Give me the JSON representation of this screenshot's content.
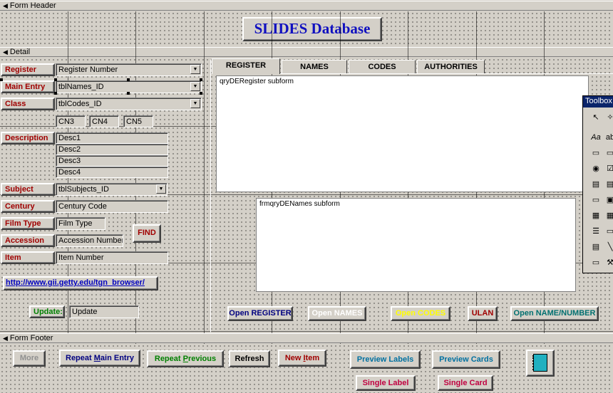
{
  "sections": {
    "header": "Form Header",
    "detail": "Detail",
    "footer": "Form Footer"
  },
  "title": "SLIDES Database",
  "fields": [
    {
      "label": "Register",
      "value": "Register Number",
      "dropdown": true
    },
    {
      "label": "Main Entry",
      "value": "tblNames_ID",
      "dropdown": true
    },
    {
      "label": "Class",
      "value": "tblCodes_ID",
      "dropdown": true
    }
  ],
  "cn_boxes": [
    "CN3",
    "CN4",
    "CN5"
  ],
  "description": {
    "label": "Description",
    "values": [
      "Desc1",
      "Desc2",
      "Desc3",
      "Desc4"
    ]
  },
  "subject": {
    "label": "Subject",
    "value": "tblSubjects_ID"
  },
  "century": {
    "label": "Century",
    "value": "Century Code"
  },
  "film_type": {
    "label": "Film Type",
    "value": "Film Type"
  },
  "accession": {
    "label": "Accession",
    "value": "Accession Number"
  },
  "item": {
    "label": "Item",
    "value": "Item Number"
  },
  "find_button": "FIND",
  "link": "http://www.gii.getty.edu/tgn_browser/",
  "update": {
    "label": "Update:",
    "value": "Update"
  },
  "tabs": [
    "REGISTER",
    "NAMES",
    "CODES",
    "AUTHORITIES"
  ],
  "subforms": {
    "register": "qryDERegister subform",
    "names": "frmqryDENames subform"
  },
  "detail_buttons": [
    {
      "label": "Open REGISTER",
      "color": "#000080"
    },
    {
      "label": "Open NAMES",
      "color": "#ffffff"
    },
    {
      "label": "Open CODES",
      "color": "#ffff00"
    },
    {
      "label": "ULAN",
      "color": "#a00000"
    },
    {
      "label": "Open NAME/NUMBER",
      "color": "#007070"
    }
  ],
  "footer_buttons": {
    "more": "More",
    "repeat_main_entry": "Repeat Main Entry",
    "repeat_previous": "Repeat Previous",
    "refresh": "Refresh",
    "new_item": "New Item",
    "preview_labels": "Preview Labels",
    "preview_cards": "Preview Cards",
    "single_label": "Single Label",
    "single_card": "Single Card"
  },
  "toolbox": {
    "title": "Toolbox",
    "icons": [
      "pointer-icon",
      "wizard-icon",
      "label-icon",
      "textbox-icon",
      "option-group-icon",
      "toggle-icon",
      "option-button-icon",
      "checkbox-icon",
      "combo-icon",
      "list-icon",
      "command-button-icon",
      "image-icon",
      "unbound-object-icon",
      "bound-object-icon",
      "page-break-icon",
      "tab-control-icon",
      "subform-icon",
      "line-icon",
      "rectangle-icon",
      "more-controls-icon"
    ]
  }
}
